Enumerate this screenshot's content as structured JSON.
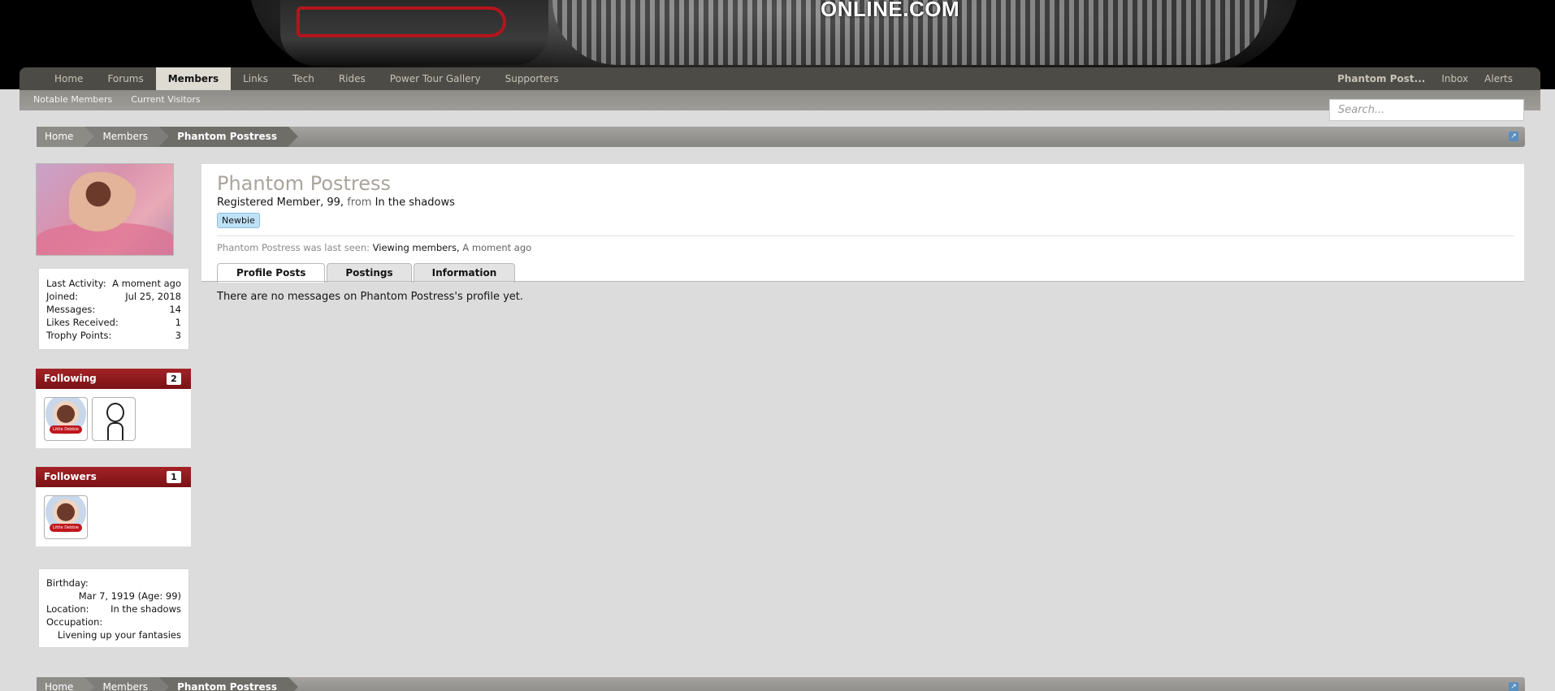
{
  "banner": {
    "logo_text": "ONLINE.COM"
  },
  "nav": {
    "tabs": [
      "Home",
      "Forums",
      "Members",
      "Links",
      "Tech",
      "Rides",
      "Power Tour Gallery",
      "Supporters"
    ],
    "active_tab": "Members",
    "right": {
      "user": "Phantom Post...",
      "inbox": "Inbox",
      "alerts": "Alerts"
    }
  },
  "subnav": {
    "items": [
      "Notable Members",
      "Current Visitors"
    ]
  },
  "search": {
    "placeholder": "Search..."
  },
  "breadcrumb": {
    "items": [
      "Home",
      "Members",
      "Phantom Postress"
    ]
  },
  "sidebar": {
    "stats": [
      {
        "label": "Last Activity:",
        "value": "A moment ago"
      },
      {
        "label": "Joined:",
        "value": "Jul 25, 2018"
      },
      {
        "label": "Messages:",
        "value": "14"
      },
      {
        "label": "Likes Received:",
        "value": "1"
      },
      {
        "label": "Trophy Points:",
        "value": "3"
      }
    ],
    "following": {
      "title": "Following",
      "count": "2"
    },
    "followers": {
      "title": "Followers",
      "count": "1"
    },
    "about": {
      "birthday_label": "Birthday:",
      "birthday_value": "Mar 7, 1919 (Age: 99)",
      "location_label": "Location:",
      "location_value": "In the shadows",
      "occupation_label": "Occupation:",
      "occupation_value": "Livening up your fantasies"
    }
  },
  "profile": {
    "username": "Phantom Postress",
    "info_prefix": "Registered Member, 99,",
    "info_from": "from",
    "location": "In the shadows",
    "rank": "Newbie",
    "last_seen_prefix": "Phantom Postress was last seen:",
    "last_seen_activity": "Viewing members,",
    "last_seen_time": "A moment ago",
    "tabs": [
      "Profile Posts",
      "Postings",
      "Information"
    ],
    "active_tab": "Profile Posts",
    "empty_message": "There are no messages on Phantom Postress's profile yet."
  },
  "colors": {
    "nav_bg": "#4d4b45",
    "block_head": "#a32226",
    "badge": "#bfe1f6"
  }
}
